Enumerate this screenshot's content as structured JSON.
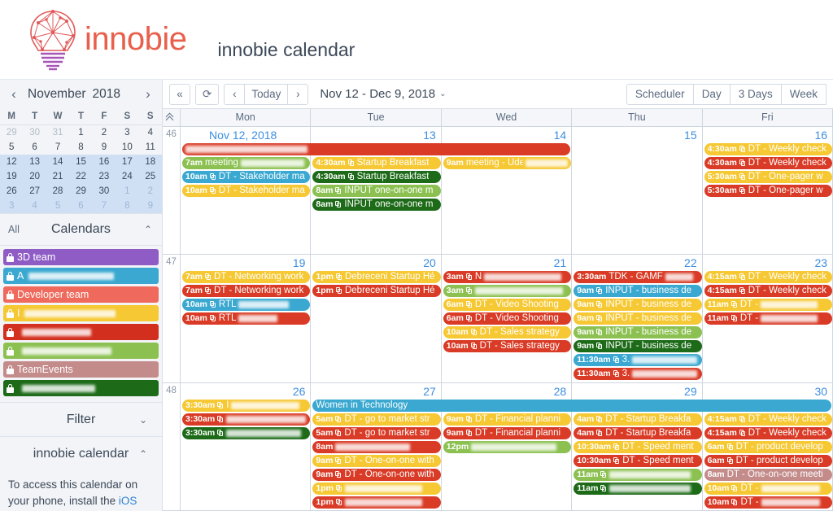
{
  "brand": {
    "word": "innobie",
    "app_title": "innobie calendar"
  },
  "sidebar": {
    "mini": {
      "prev_icon": "‹",
      "next_icon": "›",
      "month": "November",
      "year": "2018",
      "weekday_headers": [
        "M",
        "T",
        "W",
        "T",
        "F",
        "S",
        "S"
      ],
      "weeks": [
        [
          {
            "d": "29",
            "out": true
          },
          {
            "d": "30",
            "out": true
          },
          {
            "d": "31",
            "out": true
          },
          {
            "d": "1"
          },
          {
            "d": "2"
          },
          {
            "d": "3"
          },
          {
            "d": "4"
          }
        ],
        [
          {
            "d": "5"
          },
          {
            "d": "6"
          },
          {
            "d": "7"
          },
          {
            "d": "8"
          },
          {
            "d": "9"
          },
          {
            "d": "10"
          },
          {
            "d": "11"
          }
        ],
        [
          {
            "d": "12",
            "sel": true
          },
          {
            "d": "13",
            "sel": true
          },
          {
            "d": "14",
            "sel": true
          },
          {
            "d": "15",
            "sel": true
          },
          {
            "d": "16",
            "sel": true
          },
          {
            "d": "17",
            "sel": true
          },
          {
            "d": "18",
            "sel": true
          }
        ],
        [
          {
            "d": "19",
            "sel": true
          },
          {
            "d": "20",
            "sel": true
          },
          {
            "d": "21",
            "sel": true
          },
          {
            "d": "22",
            "sel": true
          },
          {
            "d": "23",
            "sel": true
          },
          {
            "d": "24",
            "sel": true
          },
          {
            "d": "25",
            "sel": true
          }
        ],
        [
          {
            "d": "26",
            "sel": true
          },
          {
            "d": "27",
            "sel": true
          },
          {
            "d": "28",
            "sel": true
          },
          {
            "d": "29",
            "sel": true
          },
          {
            "d": "30",
            "sel": true
          },
          {
            "d": "1",
            "sel": true,
            "out": true
          },
          {
            "d": "2",
            "sel": true,
            "out": true
          }
        ],
        [
          {
            "d": "3",
            "sel": true,
            "out": true
          },
          {
            "d": "4",
            "sel": true,
            "out": true
          },
          {
            "d": "5",
            "sel": true,
            "out": true
          },
          {
            "d": "6",
            "sel": true,
            "out": true
          },
          {
            "d": "7",
            "sel": true,
            "out": true
          },
          {
            "d": "8",
            "sel": true,
            "out": true
          },
          {
            "d": "9",
            "sel": true,
            "out": true
          }
        ]
      ]
    },
    "calendars_section": {
      "all_label": "All",
      "title": "Calendars",
      "collapse_icon": "⌃",
      "items": [
        {
          "label": "3D team",
          "color": "#8e5cc4",
          "redacted": false,
          "redact_w": 0
        },
        {
          "label": "A",
          "color": "#3aa8d0",
          "redacted": true,
          "redact_w": 105
        },
        {
          "label": "Developer team",
          "color": "#ef6a5c",
          "redacted": false,
          "redact_w": 0
        },
        {
          "label": "I",
          "color": "#f6c833",
          "redacted": true,
          "redact_w": 112
        },
        {
          "label": "",
          "color": "#d32f1e",
          "redacted": true,
          "redact_w": 85
        },
        {
          "label": "",
          "color": "#8cc152",
          "redacted": true,
          "redact_w": 110
        },
        {
          "label": "TeamEvents",
          "color": "#c48b8b",
          "redacted": false,
          "redact_w": 0
        },
        {
          "label": "",
          "color": "#1d6b18",
          "redacted": true,
          "redact_w": 90
        }
      ]
    },
    "filter": {
      "label": "Filter",
      "icon": "⌄"
    },
    "info": {
      "title": "innobie calendar",
      "icon": "⌃",
      "text_before": "To access this calendar on your phone, install the ",
      "link": "iOS"
    }
  },
  "toolbar": {
    "collapse_label": "«",
    "refresh_label": "⟳",
    "prev_label": "‹",
    "today_label": "Today",
    "next_label": "›",
    "range_label": "Nov 12 - Dec 9, 2018",
    "range_caret": "⌄",
    "views": [
      "Scheduler",
      "Day",
      "3 Days",
      "Week"
    ],
    "active_view": "Week"
  },
  "grid": {
    "day_headers": [
      "Mon",
      "Tue",
      "Wed",
      "Thu",
      "Fri"
    ],
    "collapse_icon": "double-chevron-up",
    "colors": {
      "yellow": "#f6c833",
      "red": "#d93b26",
      "blue": "#3aa8d0",
      "green": "#8cc152",
      "darkgreen": "#1d6b18",
      "rose": "#c48b8b",
      "crimson": "#c0392b"
    },
    "weeks": [
      {
        "week_number": "46",
        "days": [
          {
            "label": "Nov 12, 2018",
            "first": true
          },
          {
            "label": "13"
          },
          {
            "label": "14"
          },
          {
            "label": "15"
          },
          {
            "label": "16"
          }
        ],
        "spans": [
          {
            "start": 0,
            "len": 3,
            "row": 0,
            "color": "#d93b26",
            "time": "",
            "name": "",
            "redact_w": 150,
            "allday": true
          }
        ],
        "events": [
          {
            "day": 0,
            "row": 1,
            "color": "#8cc152",
            "time": "7am",
            "name": "meeting",
            "redact_w": 78,
            "copy": false
          },
          {
            "day": 0,
            "row": 2,
            "color": "#3aa8d0",
            "time": "10am",
            "name": "DT - Stakeholder ma",
            "copy": true
          },
          {
            "day": 0,
            "row": 3,
            "color": "#f6c833",
            "time": "10am",
            "name": "DT - Stakeholder ma",
            "copy": true
          },
          {
            "day": 1,
            "row": 1,
            "color": "#f6c833",
            "time": "4:30am",
            "name": "Startup Breakfast",
            "copy": true
          },
          {
            "day": 1,
            "row": 2,
            "color": "#1d6b18",
            "time": "4:30am",
            "name": "Startup Breakfast",
            "copy": true
          },
          {
            "day": 1,
            "row": 3,
            "color": "#8cc152",
            "time": "8am",
            "name": "INPUT one-on-one m",
            "copy": true
          },
          {
            "day": 1,
            "row": 4,
            "color": "#1d6b18",
            "time": "8am",
            "name": "INPUT one-on-one m",
            "copy": true
          },
          {
            "day": 2,
            "row": 1,
            "color": "#f6c833",
            "time": "9am",
            "name": "meeting - Udem",
            "redact_w": 52,
            "copy": false
          },
          {
            "day": 4,
            "row": 0,
            "color": "#f6c833",
            "time": "4:30am",
            "name": "DT - Weekly check",
            "copy": true
          },
          {
            "day": 4,
            "row": 1,
            "color": "#d93b26",
            "time": "4:30am",
            "name": "DT - Weekly check",
            "copy": true
          },
          {
            "day": 4,
            "row": 2,
            "color": "#f6c833",
            "time": "5:30am",
            "name": "DT - One-pager w",
            "copy": true
          },
          {
            "day": 4,
            "row": 3,
            "color": "#d93b26",
            "time": "5:30am",
            "name": "DT - One-pager w",
            "copy": true
          }
        ]
      },
      {
        "week_number": "47",
        "days": [
          {
            "label": "19"
          },
          {
            "label": "20"
          },
          {
            "label": "21"
          },
          {
            "label": "22"
          },
          {
            "label": "23"
          }
        ],
        "spans": [],
        "events": [
          {
            "day": 0,
            "row": 0,
            "color": "#f6c833",
            "time": "7am",
            "name": "DT - Networking work",
            "copy": true
          },
          {
            "day": 0,
            "row": 1,
            "color": "#d93b26",
            "time": "7am",
            "name": "DT - Networking work",
            "copy": true
          },
          {
            "day": 0,
            "row": 2,
            "color": "#3aa8d0",
            "time": "10am",
            "name": "RTL",
            "redact_w": 62,
            "copy": true
          },
          {
            "day": 0,
            "row": 3,
            "color": "#d93b26",
            "time": "10am",
            "name": "RTL",
            "redact_w": 48,
            "copy": true
          },
          {
            "day": 1,
            "row": 0,
            "color": "#f6c833",
            "time": "1pm",
            "name": "Debreceni Startup Hé",
            "copy": true
          },
          {
            "day": 1,
            "row": 1,
            "color": "#d93b26",
            "time": "1pm",
            "name": "Debreceni Startup Hé",
            "copy": true
          },
          {
            "day": 2,
            "row": 0,
            "color": "#d93b26",
            "time": "3am",
            "name": "N",
            "redact_w": 95,
            "copy": true
          },
          {
            "day": 2,
            "row": 1,
            "color": "#8cc152",
            "time": "3am",
            "name": "",
            "redact_w": 108,
            "copy": true
          },
          {
            "day": 2,
            "row": 2,
            "color": "#f6c833",
            "time": "6am",
            "name": "DT - Video Shooting",
            "copy": true
          },
          {
            "day": 2,
            "row": 3,
            "color": "#d93b26",
            "time": "6am",
            "name": "DT - Video Shooting",
            "copy": true
          },
          {
            "day": 2,
            "row": 4,
            "color": "#f6c833",
            "time": "10am",
            "name": "DT - Sales strategy",
            "copy": true
          },
          {
            "day": 2,
            "row": 5,
            "color": "#d93b26",
            "time": "10am",
            "name": "DT - Sales strategy",
            "copy": true
          },
          {
            "day": 3,
            "row": 0,
            "color": "#d93b26",
            "time": "3:30am",
            "name": "TDK - GAMF",
            "redact_w": 34,
            "copy": false
          },
          {
            "day": 3,
            "row": 1,
            "color": "#3aa8d0",
            "time": "9am",
            "name": "INPUT - business de",
            "copy": true
          },
          {
            "day": 3,
            "row": 2,
            "color": "#f6c833",
            "time": "9am",
            "name": "INPUT - business de",
            "copy": true
          },
          {
            "day": 3,
            "row": 3,
            "color": "#f6c833",
            "time": "9am",
            "name": "INPUT - business de",
            "copy": true
          },
          {
            "day": 3,
            "row": 4,
            "color": "#8cc152",
            "time": "9am",
            "name": "INPUT - business de",
            "copy": true
          },
          {
            "day": 3,
            "row": 5,
            "color": "#1d6b18",
            "time": "9am",
            "name": "INPUT - business de",
            "copy": true
          },
          {
            "day": 3,
            "row": 6,
            "color": "#3aa8d0",
            "time": "11:30am",
            "name": "3.",
            "redact_w": 80,
            "copy": true
          },
          {
            "day": 3,
            "row": 7,
            "color": "#d93b26",
            "time": "11:30am",
            "name": "3.",
            "redact_w": 80,
            "copy": true
          },
          {
            "day": 4,
            "row": 0,
            "color": "#f6c833",
            "time": "4:15am",
            "name": "DT - Weekly check",
            "copy": true
          },
          {
            "day": 4,
            "row": 1,
            "color": "#d93b26",
            "time": "4:15am",
            "name": "DT - Weekly check",
            "copy": true
          },
          {
            "day": 4,
            "row": 2,
            "color": "#f6c833",
            "time": "11am",
            "name": "DT -",
            "redact_w": 70,
            "copy": true
          },
          {
            "day": 4,
            "row": 3,
            "color": "#d93b26",
            "time": "11am",
            "name": "DT -",
            "redact_w": 70,
            "copy": true
          }
        ]
      },
      {
        "week_number": "48",
        "days": [
          {
            "label": "26"
          },
          {
            "label": "27"
          },
          {
            "label": "28"
          },
          {
            "label": "29"
          },
          {
            "label": "30"
          }
        ],
        "spans": [
          {
            "start": 1,
            "len": 4,
            "row": 0,
            "color": "#3aa8d0",
            "time": "",
            "name": "Women in Technology",
            "redact_w": 0,
            "allday": true
          }
        ],
        "events": [
          {
            "day": 0,
            "row": 0,
            "color": "#f6c833",
            "time": "3:30am",
            "name": "I",
            "redact_w": 84,
            "copy": true
          },
          {
            "day": 0,
            "row": 1,
            "color": "#d93b26",
            "time": "3:30am",
            "name": "",
            "redact_w": 98,
            "copy": true
          },
          {
            "day": 0,
            "row": 2,
            "color": "#1d6b18",
            "time": "3:30am",
            "name": "",
            "redact_w": 92,
            "copy": true
          },
          {
            "day": 1,
            "row": 1,
            "color": "#f6c833",
            "time": "5am",
            "name": "DT - go to market str",
            "copy": true
          },
          {
            "day": 1,
            "row": 2,
            "color": "#d93b26",
            "time": "5am",
            "name": "DT - go to market str",
            "copy": true
          },
          {
            "day": 1,
            "row": 3,
            "color": "#d93b26",
            "time": "8am",
            "name": "",
            "redact_w": 92,
            "copy": false
          },
          {
            "day": 1,
            "row": 4,
            "color": "#f6c833",
            "time": "9am",
            "name": "DT - One-on-one with",
            "copy": true
          },
          {
            "day": 1,
            "row": 5,
            "color": "#d93b26",
            "time": "9am",
            "name": "DT - One-on-one with",
            "copy": true
          },
          {
            "day": 1,
            "row": 6,
            "color": "#f6c833",
            "time": "1pm",
            "name": "",
            "redact_w": 95,
            "copy": true
          },
          {
            "day": 1,
            "row": 7,
            "color": "#d93b26",
            "time": "1pm",
            "name": "",
            "redact_w": 95,
            "copy": true
          },
          {
            "day": 2,
            "row": 1,
            "color": "#f6c833",
            "time": "9am",
            "name": "DT - Financial planni",
            "copy": true
          },
          {
            "day": 2,
            "row": 2,
            "color": "#d93b26",
            "time": "9am",
            "name": "DT - Financial planni",
            "copy": true
          },
          {
            "day": 2,
            "row": 3,
            "color": "#8cc152",
            "time": "12pm",
            "name": "",
            "redact_w": 105,
            "copy": false
          },
          {
            "day": 3,
            "row": 1,
            "color": "#f6c833",
            "time": "4am",
            "name": "DT - Startup Breakfa",
            "copy": true
          },
          {
            "day": 3,
            "row": 2,
            "color": "#d93b26",
            "time": "4am",
            "name": "DT - Startup Breakfa",
            "copy": true
          },
          {
            "day": 3,
            "row": 3,
            "color": "#f6c833",
            "time": "10:30am",
            "name": "DT - Speed ment",
            "copy": true
          },
          {
            "day": 3,
            "row": 4,
            "color": "#d93b26",
            "time": "10:30am",
            "name": "DT - Speed ment",
            "copy": true
          },
          {
            "day": 3,
            "row": 5,
            "color": "#8cc152",
            "time": "11am",
            "name": "",
            "redact_w": 100,
            "copy": true
          },
          {
            "day": 3,
            "row": 6,
            "color": "#1d6b18",
            "time": "11am",
            "name": "",
            "redact_w": 100,
            "copy": true
          },
          {
            "day": 4,
            "row": 1,
            "color": "#f6c833",
            "time": "4:15am",
            "name": "DT - Weekly check",
            "copy": true
          },
          {
            "day": 4,
            "row": 2,
            "color": "#d93b26",
            "time": "4:15am",
            "name": "DT - Weekly check",
            "copy": true
          },
          {
            "day": 4,
            "row": 3,
            "color": "#f6c833",
            "time": "6am",
            "name": "DT - product develop",
            "copy": true
          },
          {
            "day": 4,
            "row": 4,
            "color": "#d93b26",
            "time": "6am",
            "name": "DT - product develop",
            "copy": true
          },
          {
            "day": 4,
            "row": 5,
            "color": "#c48b8b",
            "time": "8am",
            "name": "DT - One-on-one meeti",
            "copy": false
          },
          {
            "day": 4,
            "row": 6,
            "color": "#f6c833",
            "time": "10am",
            "name": "DT -",
            "redact_w": 72,
            "copy": true
          },
          {
            "day": 4,
            "row": 7,
            "color": "#d93b26",
            "time": "10am",
            "name": "DT -",
            "redact_w": 72,
            "copy": true
          }
        ]
      }
    ]
  }
}
